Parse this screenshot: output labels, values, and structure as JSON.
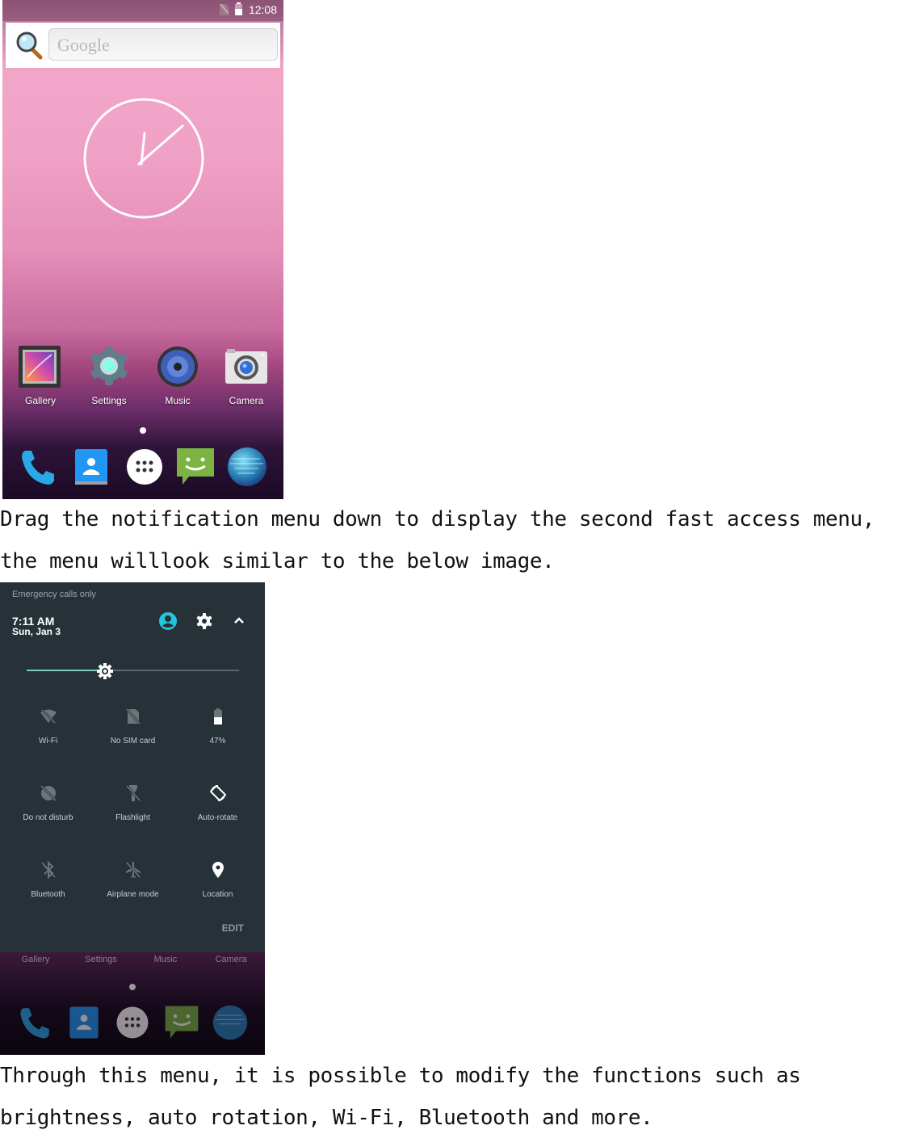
{
  "home_screen": {
    "status_bar": {
      "time": "12:08",
      "icons": [
        "no-sim-icon",
        "battery-icon"
      ]
    },
    "search_widget": {
      "placeholder": "Google",
      "icon": "magnifier-icon"
    },
    "clock_widget": {
      "type": "analog",
      "hour": 1,
      "minute": 8
    },
    "apps": [
      {
        "label": "Gallery",
        "icon": "gallery-icon"
      },
      {
        "label": "Settings",
        "icon": "settings-gear-icon"
      },
      {
        "label": "Music",
        "icon": "music-speaker-icon"
      },
      {
        "label": "Camera",
        "icon": "camera-icon"
      }
    ],
    "page_indicator": {
      "pages": 1,
      "current": 1
    },
    "dock": [
      "phone-icon",
      "contacts-icon",
      "app-drawer-icon",
      "messaging-icon",
      "browser-globe-icon"
    ]
  },
  "text": {
    "para1_line1": "Drag the notification menu down to display the second fast access menu,",
    "para1_line2": "the menu willlook similar to the below image.",
    "para2_line1": "Through this menu, it is possible to modify the functions such as",
    "para2_line2": "brightness, auto rotation, Wi-Fi, Bluetooth and more."
  },
  "quick_settings": {
    "carrier_text": "Emergency calls only",
    "time": "7:11 AM",
    "date": "Sun, Jan 3",
    "header_icons": [
      "user-avatar-icon",
      "settings-gear-icon",
      "collapse-chevron-up-icon"
    ],
    "brightness_percent": 37,
    "accent_color": "#80cbc4",
    "tiles": [
      {
        "label": "Wi-Fi",
        "icon": "wifi-off-icon",
        "active": false
      },
      {
        "label": "No SIM card",
        "icon": "no-sim-icon",
        "active": false
      },
      {
        "label": "47%",
        "icon": "battery-icon",
        "active": true
      },
      {
        "label": "Do not disturb",
        "icon": "do-not-disturb-off-icon",
        "active": false
      },
      {
        "label": "Flashlight",
        "icon": "flashlight-off-icon",
        "active": false
      },
      {
        "label": "Auto-rotate",
        "icon": "auto-rotate-icon",
        "active": true
      },
      {
        "label": "Bluetooth",
        "icon": "bluetooth-off-icon",
        "active": false
      },
      {
        "label": "Airplane mode",
        "icon": "airplane-off-icon",
        "active": false
      },
      {
        "label": "Location",
        "icon": "location-pin-icon",
        "active": true
      }
    ],
    "edit_label": "EDIT",
    "dimmed_apps": [
      "Gallery",
      "Settings",
      "Music",
      "Camera"
    ]
  }
}
